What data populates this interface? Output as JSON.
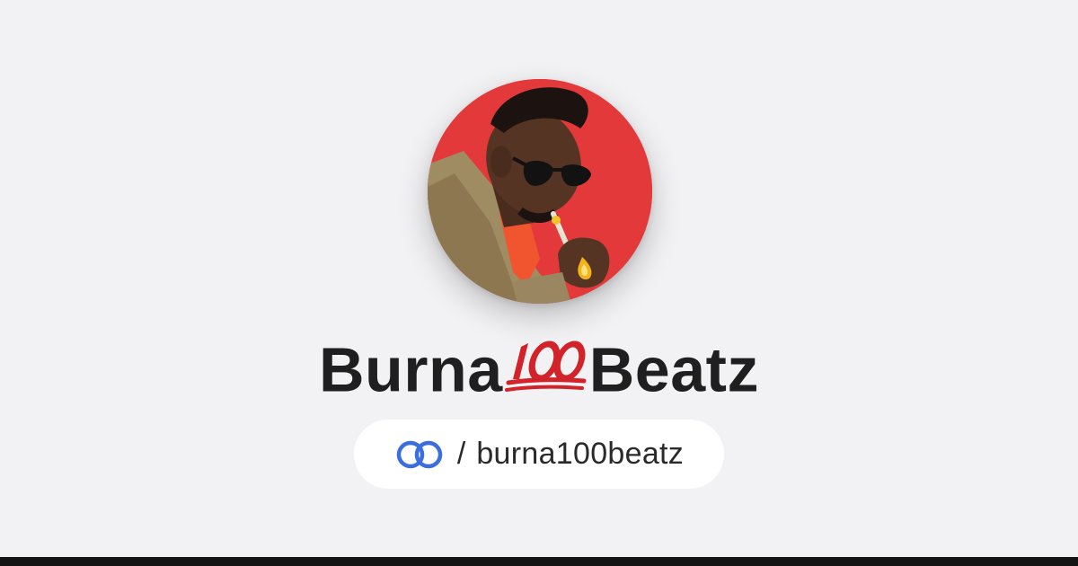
{
  "profile": {
    "name_part1": "Burna",
    "emoji": "💯",
    "emoji_name": "hundred-points-emoji",
    "name_part2": "Beatz",
    "avatar_icon": "avatar-illustration",
    "link_icon": "linked-rings-icon",
    "separator": "/",
    "handle": "burna100beatz"
  },
  "colors": {
    "background": "#f2f2f4",
    "avatar_bg": "#e3393a",
    "title": "#1f1f1f",
    "pill_bg": "#ffffff",
    "link_icon": "#3b6fe0",
    "emoji": "#d2232a",
    "bottom_bar": "#141414"
  }
}
